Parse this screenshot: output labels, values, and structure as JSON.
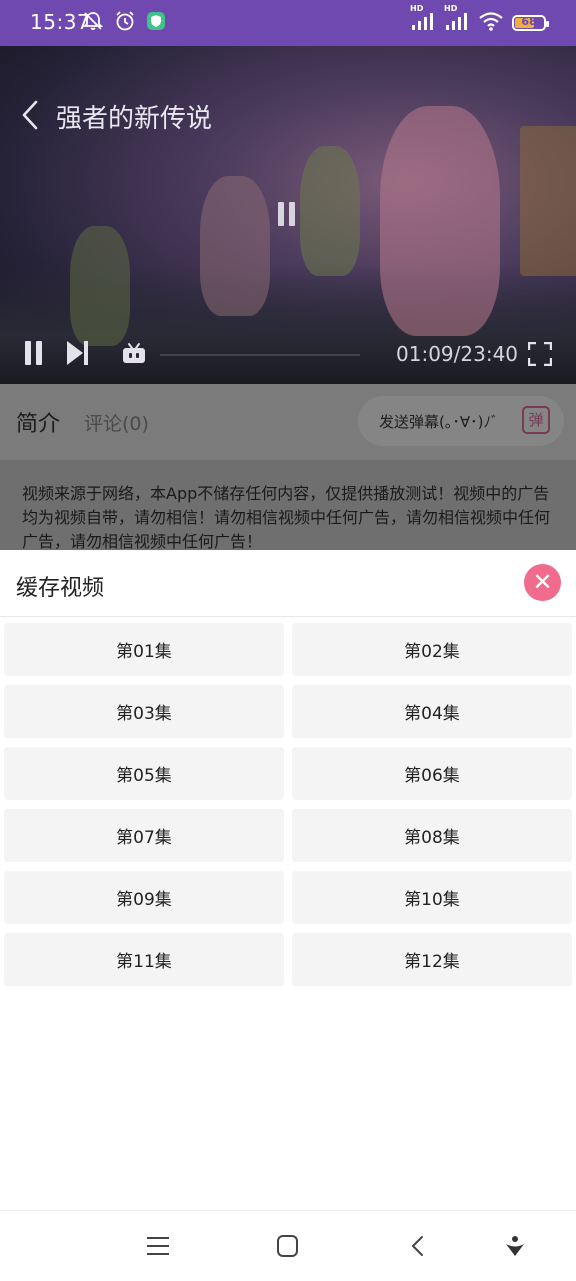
{
  "status_bar": {
    "time": "15:37",
    "battery": "68",
    "battery_level": 0.68,
    "network_labels": [
      "HD",
      "HD"
    ],
    "left_icons": [
      "bell-muted-icon",
      "alarm-icon",
      "shield-app-icon"
    ],
    "right_icons": [
      "signal-icon",
      "signal-icon",
      "wifi-icon",
      "battery-icon"
    ]
  },
  "player": {
    "title": "强者的新传说",
    "time": "01:09/23:40",
    "icons": [
      "back-arrow-icon",
      "pause-icon",
      "next-icon",
      "danmaku-toggle-icon",
      "fullscreen-icon"
    ]
  },
  "tabs": {
    "intro": "简介",
    "comments": "评论(0)"
  },
  "danmaku": {
    "placeholder": "发送弹幕(｡･∀･)ﾉﾞ",
    "icon_label": "弹"
  },
  "notice": "视频来源于网络，本App不储存任何内容，仅提供播放测试！视频中的广告均为视频自带，请勿相信！请勿相信视频中任何广告，请勿相信视频中任何广告，请勿相信视频中任何广告！",
  "cache_sheet": {
    "title": "缓存视频",
    "close": "✕",
    "episodes": [
      "第01集",
      "第02集",
      "第03集",
      "第04集",
      "第05集",
      "第06集",
      "第07集",
      "第08集",
      "第09集",
      "第10集",
      "第11集",
      "第12集"
    ]
  },
  "colors": {
    "status_bar": "#6f48b0",
    "close_button": "#f06b8c",
    "danmaku_icon": "#e2436e"
  }
}
